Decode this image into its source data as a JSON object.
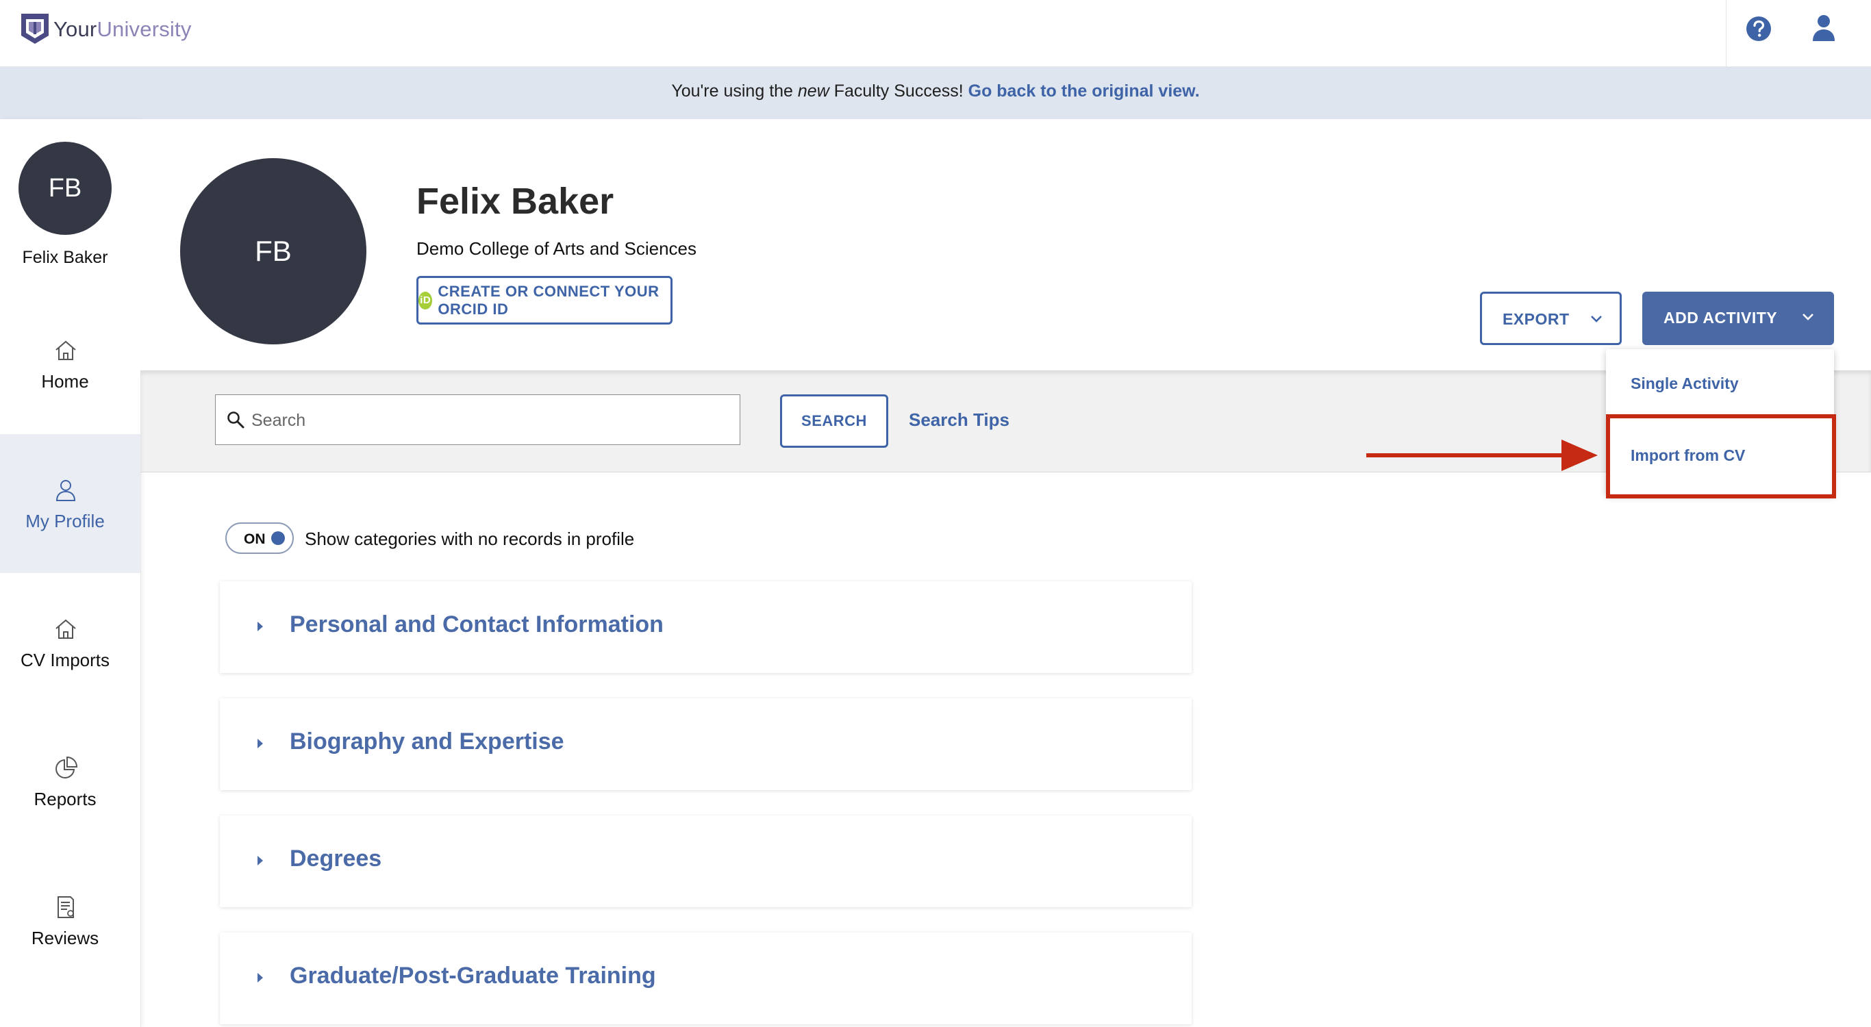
{
  "header": {
    "logo_your": "Your",
    "logo_university": "University"
  },
  "banner": {
    "prefix": "You're using the ",
    "emphasis": "new",
    "middle": " Faculty Success! ",
    "link": "Go back to the original view."
  },
  "sidebar": {
    "avatar_initials": "FB",
    "user_name": "Felix Baker",
    "items": [
      {
        "label": "Home",
        "icon": "home-icon"
      },
      {
        "label": "My Profile",
        "icon": "person-icon"
      },
      {
        "label": "CV Imports",
        "icon": "home-icon"
      },
      {
        "label": "Reports",
        "icon": "pie-chart-icon"
      },
      {
        "label": "Reviews",
        "icon": "document-icon"
      }
    ]
  },
  "profile": {
    "initials": "FB",
    "name": "Felix Baker",
    "college": "Demo College of Arts and Sciences",
    "orcid_badge": "iD",
    "orcid_label": "CREATE OR CONNECT YOUR ORCID ID"
  },
  "actions": {
    "export_label": "EXPORT",
    "add_activity_label": "ADD ACTIVITY",
    "dropdown": [
      "Single Activity",
      "Import from CV"
    ]
  },
  "search": {
    "placeholder": "Search",
    "button_label": "SEARCH",
    "tips_label": "Search Tips"
  },
  "toggle": {
    "state": "ON",
    "label": "Show categories with no records in profile"
  },
  "categories": [
    "Personal and Contact Information",
    "Biography and Expertise",
    "Degrees",
    "Graduate/Post-Graduate Training"
  ],
  "colors": {
    "primary": "#3e64a7",
    "avatar": "#343844",
    "banner": "#dfe5ef",
    "highlight": "#c62a12",
    "orcid": "#a6ce39"
  }
}
